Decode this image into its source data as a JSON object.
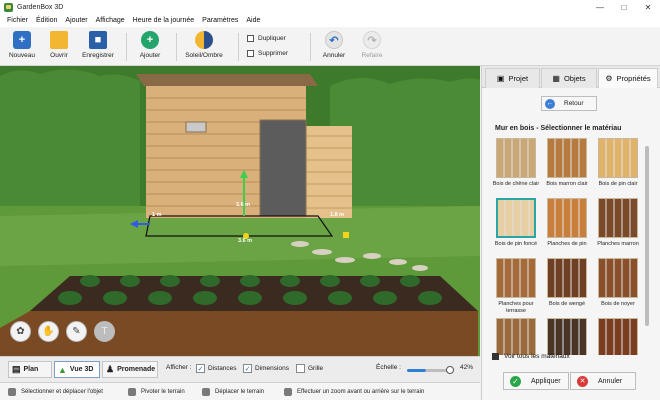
{
  "window": {
    "title": "GardenBox 3D",
    "controls": [
      "—",
      "□",
      "✕"
    ]
  },
  "menu": [
    "Fichier",
    "Édition",
    "Ajouter",
    "Affichage",
    "Heure de la journée",
    "Paramètres",
    "Aide"
  ],
  "toolbar": {
    "new": "Nouveau",
    "open": "Ouvrir",
    "save": "Enregistrer",
    "add": "Ajouter",
    "sun_shadow": "Soleil/Ombre",
    "duplicate": "Dupliquer",
    "delete": "Supprimer",
    "undo": "Annuler",
    "redo": "Refaire"
  },
  "viewport": {
    "dimension_main": "3.6 m",
    "dimension_height": "3.6 m",
    "dimension_side_left": "1 m",
    "dimension_side_right": "1.8 m"
  },
  "panel": {
    "tabs": [
      {
        "label": "Projet",
        "icon": "camera-icon"
      },
      {
        "label": "Objets",
        "icon": "cube-icon"
      },
      {
        "label": "Propriétés",
        "icon": "gear-icon"
      }
    ],
    "back_label": "Retour",
    "section_title": "Mur en bois - Sélectionner le matériau",
    "materials": [
      {
        "label": "Bois de chêne clair",
        "color": "#c9a878"
      },
      {
        "label": "Bois marron clair",
        "color": "#b77a3e"
      },
      {
        "label": "Bois de pin clair",
        "color": "#e0b26a"
      },
      {
        "label": "Bois de pin foncé",
        "color": "#e8cfa3",
        "selected": true
      },
      {
        "label": "Planches de pin",
        "color": "#c97f3c"
      },
      {
        "label": "Planches marron",
        "color": "#7a4a2a"
      },
      {
        "label": "Planches pour terrasse",
        "color": "#a56a3a"
      },
      {
        "label": "Bois de wengé",
        "color": "#6e3f22"
      },
      {
        "label": "Bois de noyer",
        "color": "#8a4f2b"
      },
      {
        "label": "",
        "color": "#9b6a3c"
      },
      {
        "label": "",
        "color": "#4a3426"
      },
      {
        "label": "",
        "color": "#7a3d20"
      }
    ],
    "see_all_label": "Voir tous les matériaux",
    "apply_label": "Appliquer",
    "cancel_label": "Annuler"
  },
  "bottom": {
    "view_tabs": [
      {
        "label": "Plan"
      },
      {
        "label": "Vue 3D"
      },
      {
        "label": "Promenade"
      }
    ],
    "show_label": "Afficher :",
    "distances_label": "Distances",
    "dimensions_label": "Dimensions",
    "grid_label": "Grille",
    "scale_label": "Échelle :",
    "scale_value": "42%",
    "scale_level": 0.42
  },
  "status": [
    "Sélectionner et déplacer l'objet",
    "Pivoter le terrain",
    "Déplacer le terrain",
    "Effectuer un zoom avant ou arrière sur le terrain"
  ]
}
